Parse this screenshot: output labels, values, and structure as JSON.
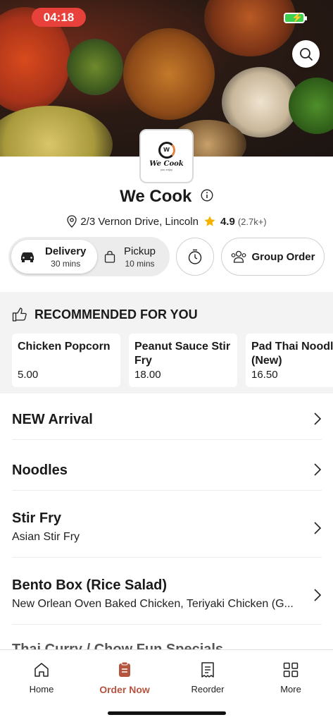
{
  "status_bar": {
    "time": "04:18"
  },
  "restaurant": {
    "name": "We Cook",
    "logo_text": "We Cook",
    "logo_tagline": "you enjoy",
    "address": "2/3 Vernon Drive, Lincoln",
    "rating": "4.9",
    "rating_count": "(2.7k+)"
  },
  "modes": {
    "delivery": {
      "label": "Delivery",
      "time": "30 mins"
    },
    "pickup": {
      "label": "Pickup",
      "time": "10 mins"
    },
    "group_order": "Group Order"
  },
  "recommended": {
    "heading": "RECOMMENDED FOR YOU",
    "items": [
      {
        "name": "Chicken Popcorn",
        "price": "5.00"
      },
      {
        "name": "Peanut Sauce Stir Fry",
        "price": "18.00"
      },
      {
        "name": "Pad Thai Noodles (New)",
        "price": "16.50"
      }
    ]
  },
  "categories": [
    {
      "name": "NEW Arrival",
      "subtitle": ""
    },
    {
      "name": "Noodles",
      "subtitle": ""
    },
    {
      "name": "Stir Fry",
      "subtitle": "Asian Stir Fry"
    },
    {
      "name": "Bento Box (Rice Salad)",
      "subtitle": "New Orlean Oven Baked Chicken, Teriyaki Chicken (G..."
    }
  ],
  "partial_category": "Thai Curry / Chow Fun Specials",
  "tabs": [
    {
      "label": "Home",
      "icon": "home-icon"
    },
    {
      "label": "Order Now",
      "icon": "order-icon"
    },
    {
      "label": "Reorder",
      "icon": "receipt-icon"
    },
    {
      "label": "More",
      "icon": "grid-icon"
    }
  ],
  "colors": {
    "accent": "#b5543f",
    "status_time_bg": "#e8403a",
    "star": "#f5b301"
  }
}
